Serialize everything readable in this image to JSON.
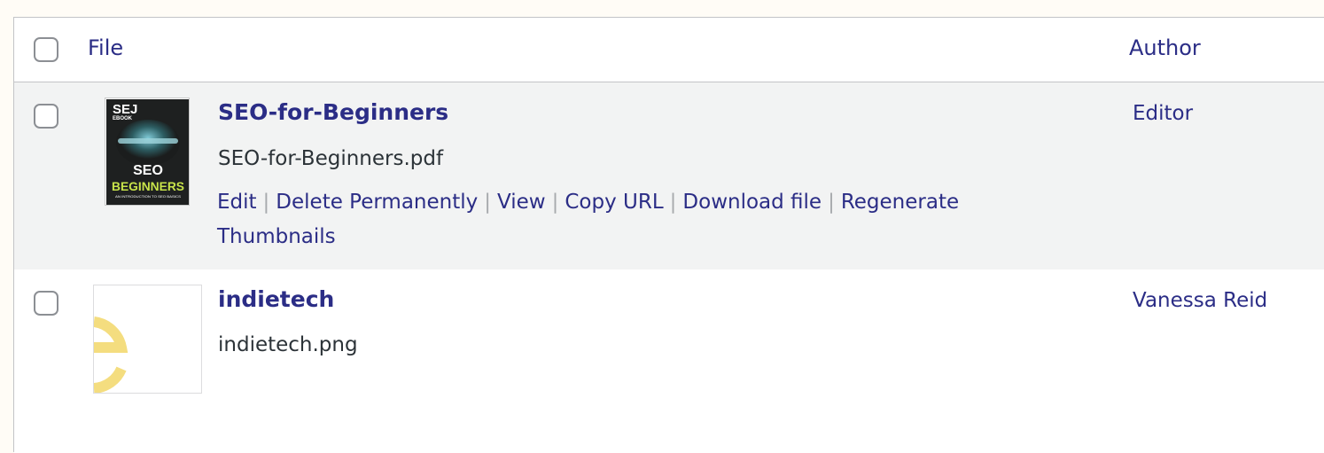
{
  "columns": {
    "file": "File",
    "author": "Author"
  },
  "rows": [
    {
      "title": "SEO-for-Beginners",
      "filename": "SEO-for-Beginners.pdf",
      "author": "Editor",
      "thumb_text": {
        "brand": "SEJ",
        "sub": "EBOOK",
        "line1": "SEO",
        "line2": "BEGINNERS",
        "tagline": "AN INTRODUCTION TO SEO BASICS"
      },
      "actions": [
        "Edit",
        "Delete Permanently",
        "View",
        "Copy URL",
        "Download file",
        "Regenerate",
        "Thumbnails"
      ]
    },
    {
      "title": "indietech",
      "filename": "indietech.png",
      "author": "Vanessa Reid"
    }
  ],
  "colors": {
    "link": "#2b2d86",
    "row_alt": "#f2f3f3",
    "page_bg": "#fffcf6",
    "logo_yellow": "#f4dd7f"
  }
}
